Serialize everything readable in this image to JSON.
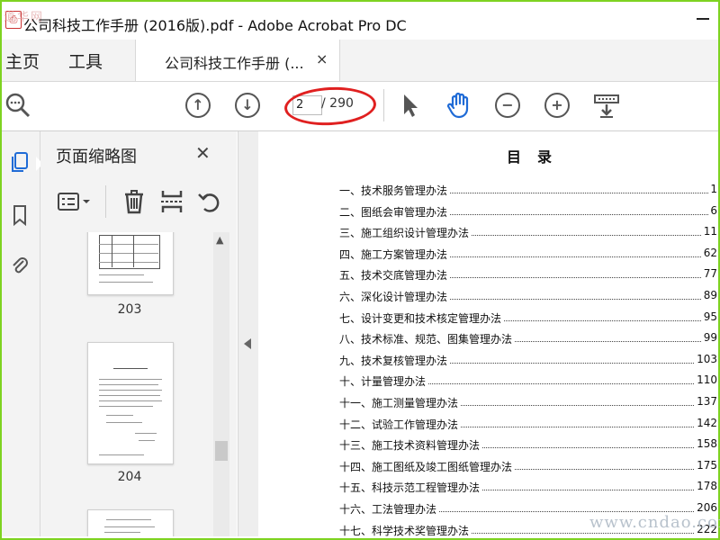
{
  "window": {
    "title": "公司科技工作手册 (2016版).pdf - Adobe Acrobat Pro DC"
  },
  "menu": {
    "home": "主页",
    "tools": "工具"
  },
  "tab": {
    "label": "公司科技工作手册 (...",
    "close": "×"
  },
  "toolbar": {
    "current_page": "2",
    "total_pages": "/ 290"
  },
  "panel": {
    "title": "页面缩略图",
    "close": "✕",
    "thumbs": [
      {
        "label": "203"
      },
      {
        "label": "204"
      }
    ]
  },
  "document": {
    "toc_title": "目录",
    "entries": [
      {
        "title": "一、技术服务管理办法",
        "page": "1"
      },
      {
        "title": "二、图纸会审管理办法",
        "page": "6"
      },
      {
        "title": "三、施工组织设计管理办法",
        "page": "11"
      },
      {
        "title": "四、施工方案管理办法",
        "page": "62"
      },
      {
        "title": "五、技术交底管理办法",
        "page": "77"
      },
      {
        "title": "六、深化设计管理办法",
        "page": "89"
      },
      {
        "title": "七、设计变更和技术核定管理办法",
        "page": "95"
      },
      {
        "title": "八、技术标准、规范、图集管理办法",
        "page": "99"
      },
      {
        "title": "九、技术复核管理办法",
        "page": "103"
      },
      {
        "title": "十、计量管理办法",
        "page": "110"
      },
      {
        "title": "十一、施工测量管理办法",
        "page": "137"
      },
      {
        "title": "十二、试验工作管理办法",
        "page": "142"
      },
      {
        "title": "十三、施工技术资料管理办法",
        "page": "158"
      },
      {
        "title": "十四、施工图纸及竣工图纸管理办法",
        "page": "175"
      },
      {
        "title": "十五、科技示范工程管理办法",
        "page": "178"
      },
      {
        "title": "十六、工法管理办法",
        "page": "206"
      },
      {
        "title": "十七、科学技术奖管理办法",
        "page": "222"
      }
    ]
  },
  "watermarks": {
    "site": "www.cndao.com",
    "logo": "道华网"
  },
  "colors": {
    "accent": "#1f6bd6",
    "annotation_ring": "#e02020",
    "frame": "#7ed321"
  }
}
